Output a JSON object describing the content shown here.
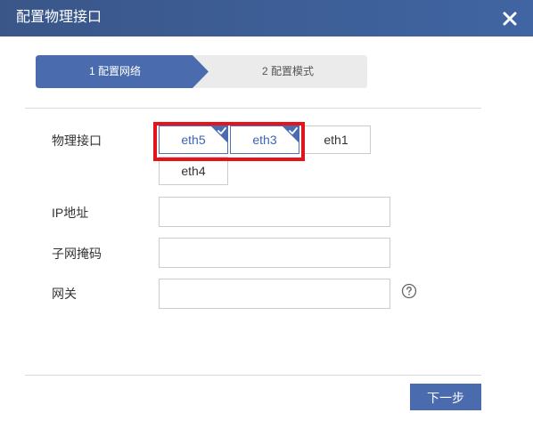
{
  "dialog": {
    "title": "配置物理接口",
    "close_icon": "close-icon"
  },
  "steps": [
    {
      "label": "1 配置网络",
      "active": true
    },
    {
      "label": "2 配置模式",
      "active": false
    }
  ],
  "colors": {
    "titlebar": "#3a5689",
    "active_step": "#4a6cae",
    "inactive_step": "#ebebeb",
    "selected_border": "#4a73b8",
    "highlight": "#e3151a",
    "next_button": "#4a6cae"
  },
  "form": {
    "interface_label": "物理接口",
    "interfaces": [
      {
        "name": "eth5",
        "selected": true
      },
      {
        "name": "eth3",
        "selected": true
      },
      {
        "name": "eth1",
        "selected": false
      },
      {
        "name": "eth4",
        "selected": false
      }
    ],
    "ip_label": "IP地址",
    "ip_value": "",
    "mask_label": "子网掩码",
    "mask_value": "",
    "gateway_label": "网关",
    "gateway_value": "",
    "help_icon": "question-circle-icon"
  },
  "footer": {
    "next_label": "下一步"
  }
}
